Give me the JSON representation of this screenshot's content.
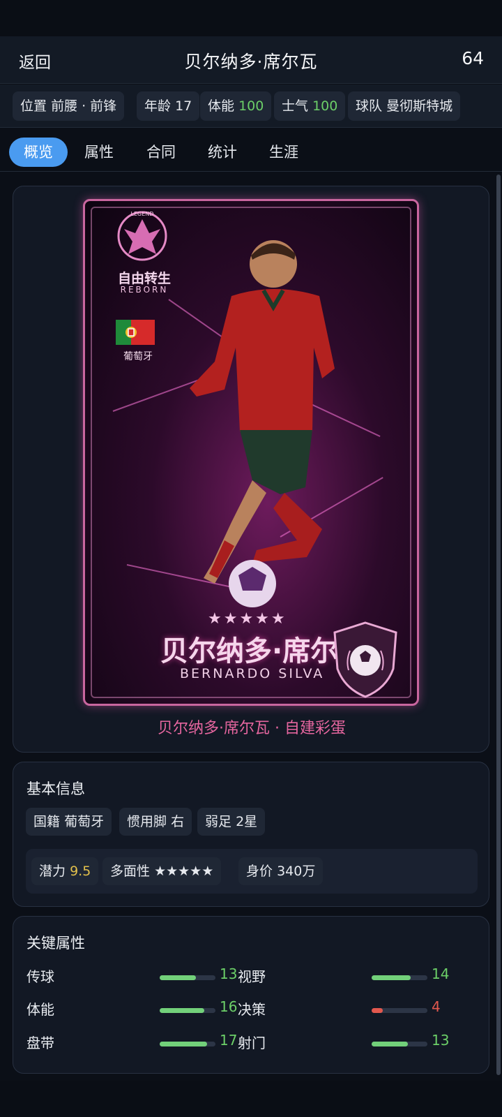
{
  "header": {
    "back_label": "返回",
    "title": "贝尔纳多·席尔瓦",
    "overall": "64"
  },
  "chips": {
    "position_label": "位置",
    "position_value": "前腰 · 前锋",
    "age_label": "年龄",
    "age_value": "17",
    "stamina_label": "体能",
    "stamina_value": "100",
    "morale_label": "士气",
    "morale_value": "100",
    "team_label": "球队",
    "team_value": "曼彻斯特城"
  },
  "tabs": [
    "概览",
    "属性",
    "合同",
    "统计",
    "生涯"
  ],
  "active_tab": "概览",
  "card_art": {
    "crest_name": "自由转生",
    "crest_sub": "REBORN",
    "crest_tag": "LEGEND",
    "nation": "葡萄牙",
    "stars": "★★★★★",
    "name_cn": "贝尔纳多·席尔瓦",
    "name_en": "BERNARDO SILVA",
    "caption": "贝尔纳多·席尔瓦 · 自建彩蛋"
  },
  "basic_info": {
    "title": "基本信息",
    "nationality_label": "国籍",
    "nationality_value": "葡萄牙",
    "foot_label": "惯用脚",
    "foot_value": "右",
    "weak_foot_label": "弱足",
    "weak_foot_value": "2星",
    "potential_label": "潜力",
    "potential_value": "9.5",
    "versatility_label": "多面性",
    "versatility_value": "★★★★★",
    "value_label": "身价",
    "value_value": "340万"
  },
  "key_attributes": {
    "title": "关键属性",
    "max": 20,
    "items": [
      {
        "label": "传球",
        "value": 13
      },
      {
        "label": "视野",
        "value": 14
      },
      {
        "label": "体能",
        "value": 16
      },
      {
        "label": "决策",
        "value": 4
      },
      {
        "label": "盘带",
        "value": 17
      },
      {
        "label": "射门",
        "value": 13
      }
    ]
  },
  "colors": {
    "accent": "#4a9bf0",
    "good": "#6ccf68",
    "bad": "#e2584e",
    "gold": "#e2c04c",
    "caption": "#e6669f"
  }
}
